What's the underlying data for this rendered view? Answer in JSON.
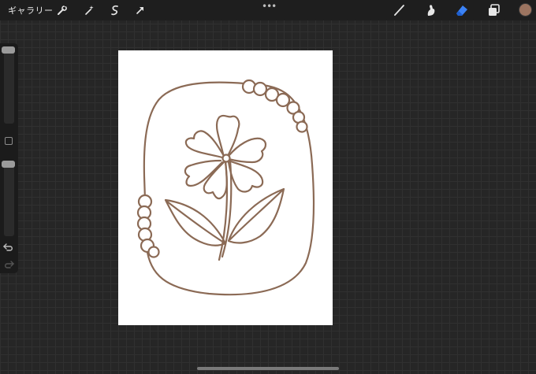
{
  "topbar": {
    "gallery_label": "ギャラリー",
    "more_label": "•••",
    "left_tools": [
      "wrench-icon",
      "magic-wand-icon",
      "selection-icon",
      "transform-icon"
    ],
    "right_tools": [
      "brush-icon",
      "smudge-icon",
      "eraser-icon",
      "layers-icon"
    ],
    "active_tool": "eraser",
    "active_color": "#9c7460",
    "accent_color": "#3b82f6"
  },
  "sidebar": {
    "brush_size_level": 0.0,
    "opacity_level": 0.0
  },
  "canvas": {
    "line_color": "#8b6a55",
    "background": "#ffffff"
  }
}
